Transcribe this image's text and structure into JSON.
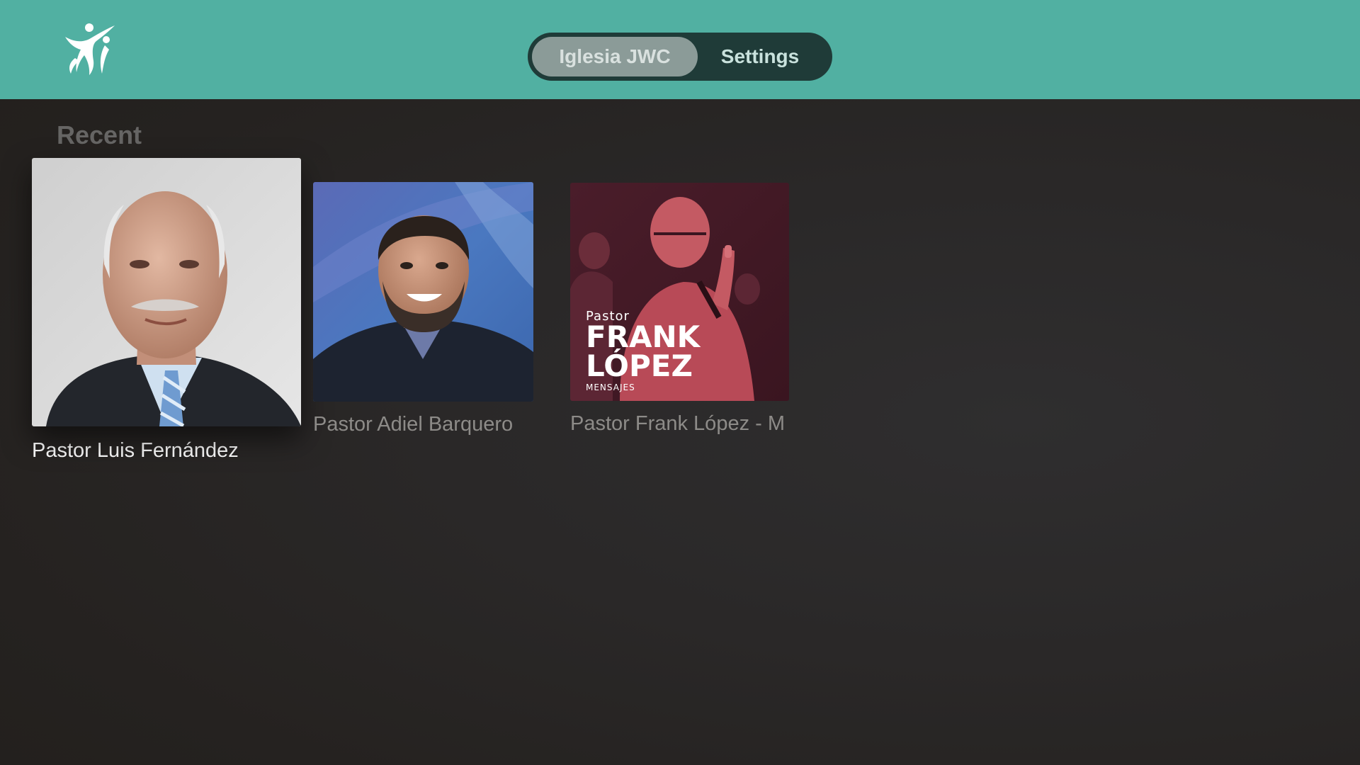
{
  "app": {
    "logo_icon": "iglesia-jwc-logo-icon",
    "brand_color": "#51b0a2"
  },
  "nav": {
    "tabs": [
      {
        "label": "Iglesia JWC",
        "selected": true
      },
      {
        "label": "Settings",
        "selected": false
      }
    ]
  },
  "recent": {
    "title": "Recent",
    "items": [
      {
        "caption": "Pastor Luis Fernández",
        "focused": true
      },
      {
        "caption": "Pastor Adiel Barquero",
        "focused": false
      },
      {
        "caption": "Pastor Frank López - M",
        "focused": false,
        "artwork_text": {
          "line1": "Pastor",
          "line2": "FRANK",
          "line3": "LÓPEZ",
          "line4": "MENSAJES"
        }
      }
    ]
  }
}
